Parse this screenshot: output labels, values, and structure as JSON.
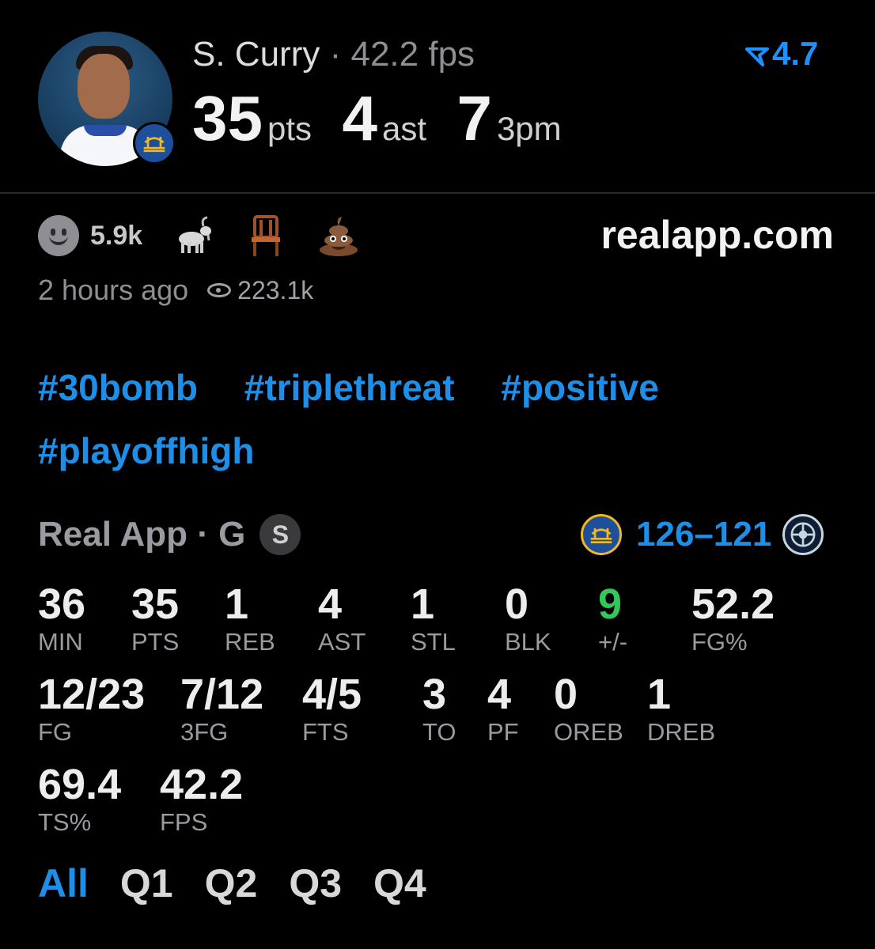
{
  "player": {
    "name": "S. Curry",
    "separator": "·",
    "fps": "42.2 fps",
    "rating": "4.7",
    "headline": [
      {
        "value": "35",
        "unit": "pts"
      },
      {
        "value": "4",
        "unit": "ast"
      },
      {
        "value": "7",
        "unit": "3pm"
      }
    ]
  },
  "reactions": {
    "smiley_count": "5.9k",
    "icons": [
      "goat-emoji",
      "chair-emoji",
      "poop-emoji"
    ]
  },
  "site": "realapp.com",
  "meta": {
    "time_ago": "2 hours ago",
    "views": "223.1k"
  },
  "tags": [
    "#30bomb",
    "#triplethreat",
    "#positive",
    "#playoffhigh"
  ],
  "game": {
    "source": "Real App · G",
    "badge": "S",
    "score_home": "126",
    "score_dash": "–",
    "score_away": "121"
  },
  "stats_row1": [
    {
      "value": "36",
      "label": "MIN"
    },
    {
      "value": "35",
      "label": "PTS"
    },
    {
      "value": "1",
      "label": "REB"
    },
    {
      "value": "4",
      "label": "AST"
    },
    {
      "value": "1",
      "label": "STL"
    },
    {
      "value": "0",
      "label": "BLK"
    },
    {
      "value": "9",
      "label": "+/-"
    },
    {
      "value": "52.2",
      "label": "FG%"
    }
  ],
  "stats_row2": [
    {
      "value": "12/23",
      "label": "FG"
    },
    {
      "value": "7/12",
      "label": "3FG"
    },
    {
      "value": "4/5",
      "label": "FTS"
    },
    {
      "value": "3",
      "label": "TO"
    },
    {
      "value": "4",
      "label": "PF"
    },
    {
      "value": "0",
      "label": "OREB"
    },
    {
      "value": "1",
      "label": "DREB"
    }
  ],
  "stats_row3": [
    {
      "value": "69.4",
      "label": "TS%"
    },
    {
      "value": "42.2",
      "label": "FPS"
    }
  ],
  "quarter_tabs": [
    "All",
    "Q1",
    "Q2",
    "Q3",
    "Q4"
  ],
  "colors": {
    "accent": "#1e8fe8",
    "positive": "#34c759",
    "background": "#000000"
  }
}
